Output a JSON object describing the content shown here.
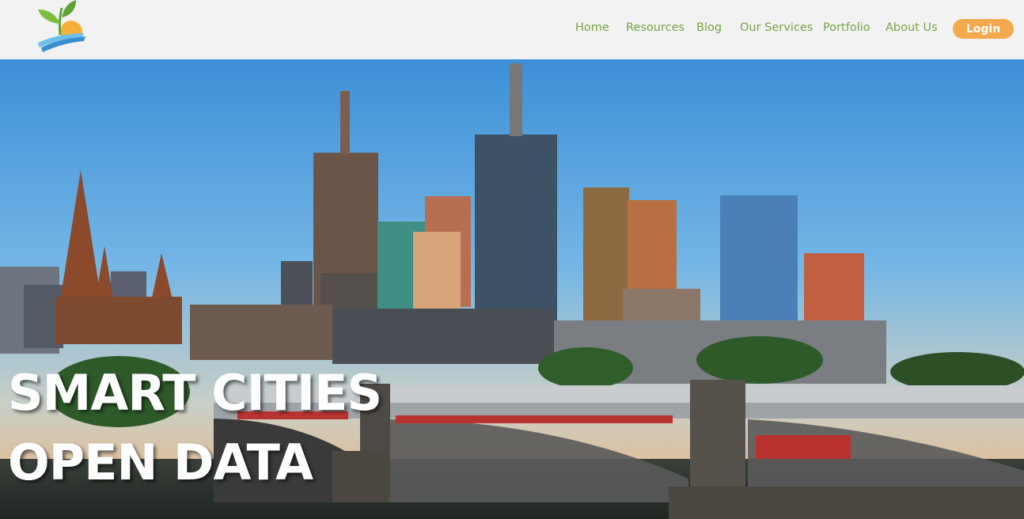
{
  "header": {
    "logo_icon": "sprout-solar-wave-logo",
    "nav": [
      {
        "label": "Home"
      },
      {
        "label": "Resources"
      },
      {
        "label": "Blog"
      },
      {
        "label": "Our Services"
      },
      {
        "label": "Portfolio"
      },
      {
        "label": "About Us"
      }
    ],
    "login_label": "Login",
    "colors": {
      "nav_text": "#77a548",
      "login_bg": "#f5a94d",
      "header_bg": "#f2f2f2"
    }
  },
  "hero": {
    "image": "melbourne-skyline-princes-bridge",
    "title_line1": "SMART CITIES",
    "title_line2": "OPEN DATA"
  }
}
